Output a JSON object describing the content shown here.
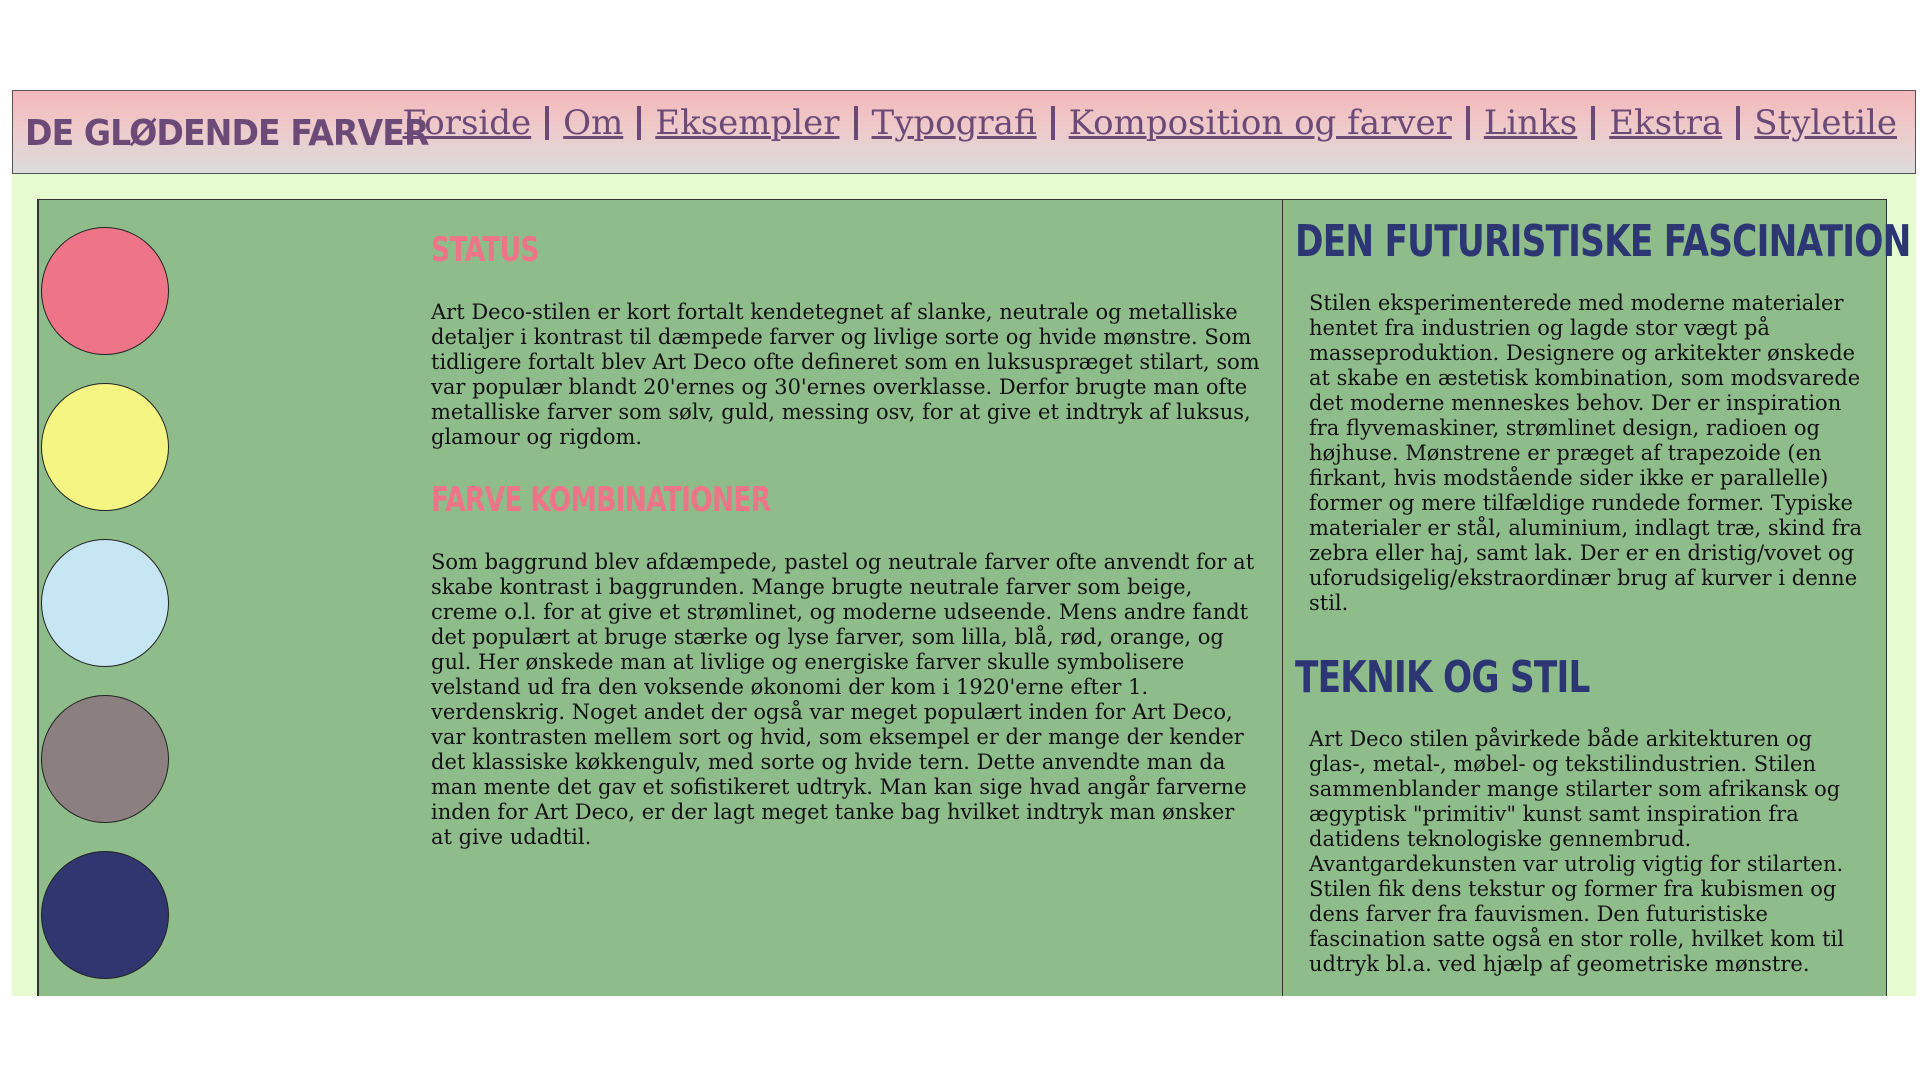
{
  "header": {
    "brand": "De glødende farver",
    "nav": [
      "Forside",
      "Om",
      "Eksempler",
      "Typografi",
      "Komposition og farver",
      "Links",
      "Ekstra",
      "Styletile"
    ]
  },
  "swatches": {
    "colors": [
      "#ee7588",
      "#f4f583",
      "#c6e6f4",
      "#8c7f7f",
      "#2f3670"
    ]
  },
  "status": {
    "heading": "Status",
    "text": "Art Deco-stilen er kort fortalt kendetegnet af slanke, neutrale og metalliske detaljer i kontrast til dæmpede farver og livlige sorte og hvide mønstre. Som tidligere fortalt blev Art Deco ofte defineret som en luksuspræget stilart, som var populær blandt 20'ernes og 30'ernes overklasse. Derfor brugte man ofte metalliske farver som sølv, guld, messing osv, for at give et indtryk af luksus, glamour og rigdom."
  },
  "combinations": {
    "heading": "Farve kombinationer",
    "text": "Som baggrund blev afdæmpede, pastel og neutrale farver ofte anvendt for at skabe kontrast i baggrunden. Mange brugte neutrale farver som beige, creme o.l. for at give et strømlinet, og moderne udseende. Mens andre fandt det populært at bruge stærke og lyse farver, som lilla, blå, rød, orange, og gul. Her ønskede man at livlige og energiske farver skulle symbolisere velstand ud fra den voksende økonomi der kom i 1920'erne efter 1. verdenskrig. Noget andet der også var meget populært inden for Art Deco, var kontrasten mellem sort og hvid, som eksempel er der mange der kender det klassiske køkkengulv, med sorte og hvide tern. Dette anvendte man da man mente det gav et sofistikeret udtryk. Man kan sige hvad angår farverne inden for Art Deco, er der lagt meget tanke bag hvilket indtryk man ønsker at give udadtil."
  },
  "futuristic": {
    "heading": "Den futuristiske fascination",
    "text": "Stilen eksperimenterede med moderne materialer hentet fra industrien og lagde stor vægt på masseproduktion. Designere og arkitekter ønskede at skabe en æstetisk kombination, som modsvarede det moderne menneskes behov. Der er inspiration fra flyvemaskiner, strømlinet design, radioen og højhuse. Mønstrene er præget af trapezoide (en firkant, hvis modstående sider ikke er parallelle) former og mere tilfældige rundede former. Typiske materialer er stål, aluminium, indlagt træ, skind fra zebra eller haj, samt lak. Der er en dristig/vovet og uforudsigelig/ekstraordinær brug af kurver i denne stil."
  },
  "technique": {
    "heading": "Teknik og stil",
    "text": "Art Deco stilen påvirkede både arkitekturen og glas-, metal-, møbel- og tekstilindustrien. Stilen sammenblander mange stilarter som afrikansk og ægyptisk \"primitiv\" kunst samt inspiration fra datidens teknologiske gennembrud. Avantgardekunsten var utrolig vigtig for stilarten. Stilen fik dens tekstur og former fra kubismen og dens farver fra fauvismen. Den futuristiske fascination satte også en stor rolle, hvilket kom til udtryk bl.a. ved hjælp af geometriske mønstre."
  }
}
